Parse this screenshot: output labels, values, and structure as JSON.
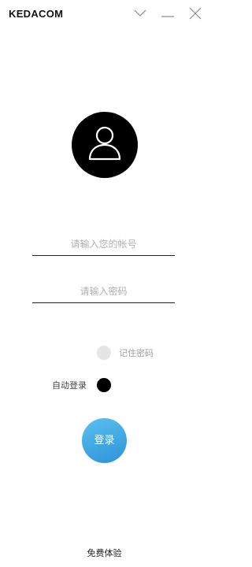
{
  "app": {
    "logo_text": "KEDACOM"
  },
  "window_controls": {
    "expand_icon": "chevron-down-icon",
    "minimize_icon": "minimize-icon",
    "close_icon": "close-icon"
  },
  "avatar": {
    "icon": "user-icon"
  },
  "form": {
    "account_placeholder": "请输入您的帐号",
    "password_placeholder": "请输入密码",
    "remember_label": "记住密码",
    "auto_login_label": "自动登录",
    "login_label": "登录"
  },
  "footer": {
    "trial_label": "免费体验"
  },
  "colors": {
    "login_button": "#3aa3e0",
    "auto_login_checked": "#000000",
    "remember_unchecked": "#e5e5e5"
  }
}
